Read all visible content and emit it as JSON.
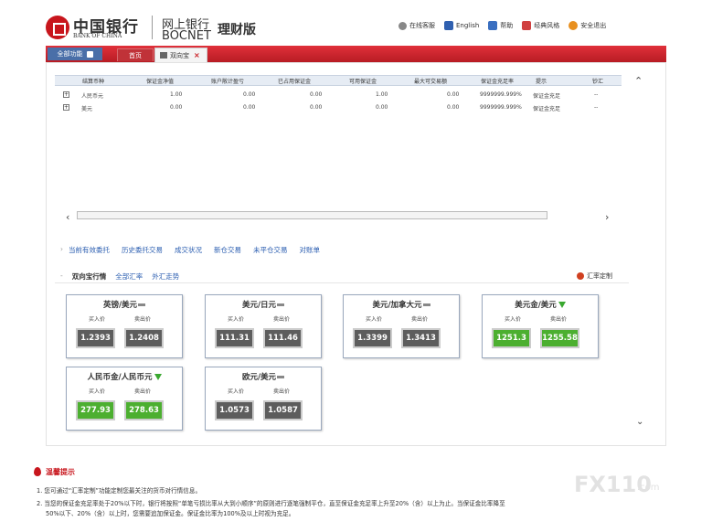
{
  "header": {
    "bank_name_cn": "中国银行",
    "bank_name_en": "BANK OF CHINA",
    "ebank_cn": "网上银行",
    "ebank_en": "BOCNET",
    "edition": "理财版",
    "links": [
      {
        "label": "在线客服",
        "icon": "headset-icon"
      },
      {
        "label": "English",
        "icon": "flag-icon"
      },
      {
        "label": "帮助",
        "icon": "help-book-icon"
      },
      {
        "label": "经典风格",
        "icon": "style-icon"
      },
      {
        "label": "安全退出",
        "icon": "exit-icon"
      }
    ]
  },
  "nav": {
    "menu_label": "全部功能",
    "home_tab": "首页",
    "active_tab": "双向宝"
  },
  "balance_table": {
    "headers": [
      "结算币种",
      "保证金净值",
      "账户敞计盈亏",
      "已占用保证金",
      "可用保证金",
      "最大可交易额",
      "保证金充足率",
      "提示",
      "钞汇"
    ],
    "rows": [
      {
        "currency": "人民币元",
        "net": "1.00",
        "pnl": "0.00",
        "used": "0.00",
        "avail": "1.00",
        "max": "0.00",
        "ratio": "9999999.999%",
        "hint": "保证金充足",
        "cash": "--"
      },
      {
        "currency": "美元",
        "net": "0.00",
        "pnl": "0.00",
        "used": "0.00",
        "avail": "0.00",
        "max": "0.00",
        "ratio": "9999999.999%",
        "hint": "保证金充足",
        "cash": "--"
      }
    ]
  },
  "links": [
    "当前有效委托",
    "历史委托交易",
    "成交状况",
    "新仓交易",
    "未平仓交易",
    "对账单"
  ],
  "section": {
    "tabs": [
      "双向宝行情",
      "全部汇率",
      "外汇走势"
    ],
    "custom_label": "汇率定制"
  },
  "quotes": {
    "buy_label": "买入价",
    "sell_label": "卖出价",
    "cards": [
      {
        "pair": "英镑/美元",
        "buy": "1.2393",
        "sell": "1.2408",
        "trend": "flat",
        "color": "#5d5d5d"
      },
      {
        "pair": "美元/日元",
        "buy": "111.31",
        "sell": "111.46",
        "trend": "flat",
        "color": "#5d5d5d"
      },
      {
        "pair": "美元/加拿大元",
        "buy": "1.3399",
        "sell": "1.3413",
        "trend": "flat",
        "color": "#5d5d5d"
      },
      {
        "pair": "美元金/美元",
        "buy": "1251.3",
        "sell": "1255.58",
        "trend": "down",
        "color": "#4caf30"
      },
      {
        "pair": "人民币金/人民币元",
        "buy": "277.93",
        "sell": "278.63",
        "trend": "down",
        "color": "#4caf30"
      },
      {
        "pair": "欧元/美元",
        "buy": "1.0573",
        "sell": "1.0587",
        "trend": "flat",
        "color": "#5d5d5d"
      }
    ]
  },
  "tips": {
    "title": "温馨提示",
    "items": [
      "1. 您可通过“汇率定制”功能定制您最关注的货币对行情信息。",
      "2. 当您的保证金充足率处于20%以下时，银行将按照“单笔亏损比率从大到小顺序”的原则进行逐笔强制平仓，直至保证金充足率上升至20%（含）以上为止。当保证金比率降至",
      "50%以下、20%（含）以上时，您需要追加保证金。保证金比率为100%及以上时视为充足。"
    ]
  },
  "watermark": {
    "main": "FX110",
    "suffix": ".com"
  }
}
